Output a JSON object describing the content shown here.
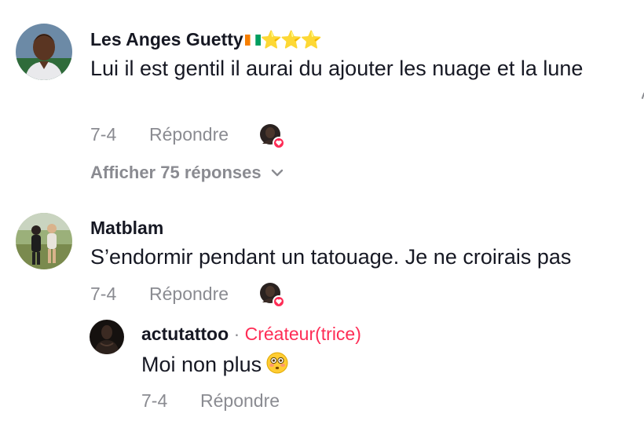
{
  "comments": [
    {
      "username": "Les Anges Guetty",
      "badges_text": "⭐⭐⭐",
      "text": "Lui il est gentil il aurai du ajouter les nuage et la lune",
      "date": "7-4",
      "reply_label": "Répondre",
      "liked_by_creator": true,
      "view_replies_label": "Afficher 75 réponses"
    },
    {
      "username": "Matblam",
      "text": "S’endormir pendant un tatouage. Je ne croirais pas",
      "date": "7-4",
      "reply_label": "Répondre",
      "liked_by_creator": true,
      "replies": [
        {
          "username": "actutattoo",
          "separator": "·",
          "creator_label": "Créateur(trice)",
          "text": "Moi non plus",
          "emoji": "flushed-face",
          "date": "7-4",
          "reply_label": "Répondre"
        }
      ]
    }
  ],
  "colors": {
    "text": "#161823",
    "secondary": "#8a8b91",
    "accent": "#fe2c55"
  }
}
